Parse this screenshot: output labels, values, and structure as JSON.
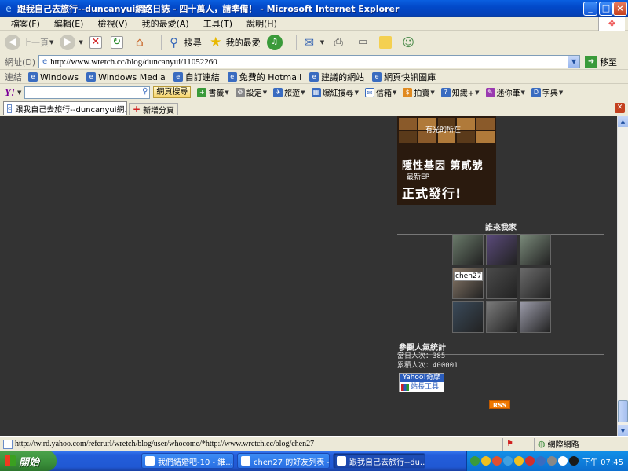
{
  "window": {
    "title": "跟我自己去旅行--duncanyui網路日誌 - 四十萬人，請準備！ - Microsoft Internet Explorer"
  },
  "menubar": {
    "items": [
      "檔案(F)",
      "編輯(E)",
      "檢視(V)",
      "我的最愛(A)",
      "工具(T)",
      "說明(H)"
    ]
  },
  "toolbar": {
    "back_label": "上一頁",
    "search_label": "搜尋",
    "favorites_label": "我的最愛"
  },
  "address": {
    "label": "網址(D)",
    "url": "http://www.wretch.cc/blog/duncanyui/11052260",
    "go_label": "移至"
  },
  "links": {
    "label": "連結",
    "items": [
      "Windows",
      "Windows Media",
      "自訂連結",
      "免費的 Hotmail",
      "建議的網站",
      "網頁快訊圖庫"
    ]
  },
  "yahoo": {
    "logo": "Y!",
    "search_value": "",
    "search_button": "網頁搜尋",
    "items": [
      "書籤",
      "設定",
      "旅遊",
      "爆紅搜尋",
      "信箱",
      "拍賣",
      "知識+",
      "迷你筆",
      "字典"
    ]
  },
  "tabs": {
    "items": [
      {
        "label": "跟我自己去旅行--duncanyui網..."
      }
    ],
    "new_tab_label": "新增分頁"
  },
  "content": {
    "banner": {
      "subline": "有光的所在",
      "line1": "隱性基因 第貳號",
      "line2": "最新EP",
      "line3": "正式發行!"
    },
    "visitors_title": "誰來我家",
    "visitors": [
      {
        "label": ""
      },
      {
        "label": ""
      },
      {
        "label": ""
      },
      {
        "label": "chen27"
      },
      {
        "label": ""
      },
      {
        "label": ""
      },
      {
        "label": ""
      },
      {
        "label": ""
      },
      {
        "label": ""
      }
    ],
    "visitor_colors": [
      "#6a7a6a",
      "#5a4a7a",
      "#7a8a7a",
      "#8a7a6a",
      "#4a4a4a",
      "#6a6a6a",
      "#3a4a5a",
      "#7a7a7a",
      "#9a9aa8"
    ],
    "stats_title": "參觀人氣統計",
    "today_label": "當日人次：",
    "today_value": "385",
    "total_label": "累積人次：",
    "total_value": "400001",
    "widget_top": "Yahoo!奇摩",
    "widget_bottom": "站長工具",
    "rss_label": "RSS"
  },
  "status": {
    "text": "http://tw.rd.yahoo.com/referurl/wretch/blog/user/whocome/*http://www.wretch.cc/blog/chen27",
    "zone": "網際網路"
  },
  "taskbar": {
    "start_label": "開始",
    "tasks": [
      {
        "label": "我們結婚吧-10 - 維..."
      },
      {
        "label": "chen27 的好友列表 - ..."
      },
      {
        "label": "跟我自己去旅行--du..."
      }
    ],
    "clock": "下午 07:45"
  }
}
